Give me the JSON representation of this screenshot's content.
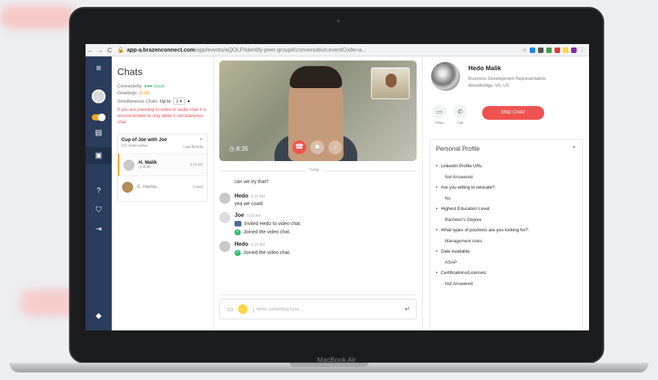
{
  "browser": {
    "url_host": "app-a.brazenconnect.com",
    "url_path": "/app/events/aQOLP/identify-peer-group#!conversation;eventCode=a..."
  },
  "chats_panel": {
    "title": "Chats",
    "connectivity_label": "Connectivity:",
    "connectivity_value": "Good",
    "greetings_label": "Greetings:",
    "greetings_edit": "[Edit]",
    "simultaneous_label": "Simultaneous Chats:",
    "simultaneous_upto": "Up to",
    "simultaneous_value": "2",
    "warning": "If you are planning to video or audio chat it is recommended to only allow 1 simultaneous chat.",
    "group": {
      "title": "Cup of Joe with Joe",
      "active_count": "1/2 chats active",
      "sort_label": "Last Activity"
    },
    "rows": [
      {
        "name": "H. Malik",
        "timer": "8:35",
        "time": "9:25 AM"
      },
      {
        "name": "E. Haxhiu",
        "status": "Ended"
      }
    ]
  },
  "video": {
    "timer": "8:35"
  },
  "conversation": {
    "date_label": "Today",
    "messages": [
      {
        "text": "can we try that?"
      },
      {
        "name": "Hedo",
        "time": "9:25 AM",
        "text": "yea we could"
      },
      {
        "name": "Joe",
        "time": "9:25 AM",
        "lines": [
          "Invited Hedo to video chat.",
          "Joined the video chat."
        ]
      },
      {
        "name": "Hedo",
        "time": "9:25 AM",
        "text": "Joined the video chat."
      }
    ],
    "composer_placeholder": "Write something here..."
  },
  "profile": {
    "name": "Hedo Malik",
    "role": "Business Development Representative",
    "location": "Woodbridge, VA, US",
    "video_label": "Video",
    "call_label": "Call",
    "end_chat_label": "END CHAT",
    "section_title": "Personal Profile",
    "items": [
      {
        "q": "LinkedIn Profile URL:",
        "a": "Not Answered"
      },
      {
        "q": "Are you willing to relocate?:",
        "a": "No"
      },
      {
        "q": "Highest Education Level:",
        "a": "Bachelor's Degree"
      },
      {
        "q": "What types of positions are you looking for?:",
        "a": "Management roles"
      },
      {
        "q": "Date Available:",
        "a": "ASAP"
      },
      {
        "q": "Certifications/Licenses:",
        "a": "Not Answered"
      }
    ]
  },
  "device": {
    "brand": "MacBook Air"
  },
  "colors": {
    "accent": "#f5a623",
    "end_chat": "#ef5350",
    "rail": "#2a3d5c",
    "good": "#32b35d"
  }
}
